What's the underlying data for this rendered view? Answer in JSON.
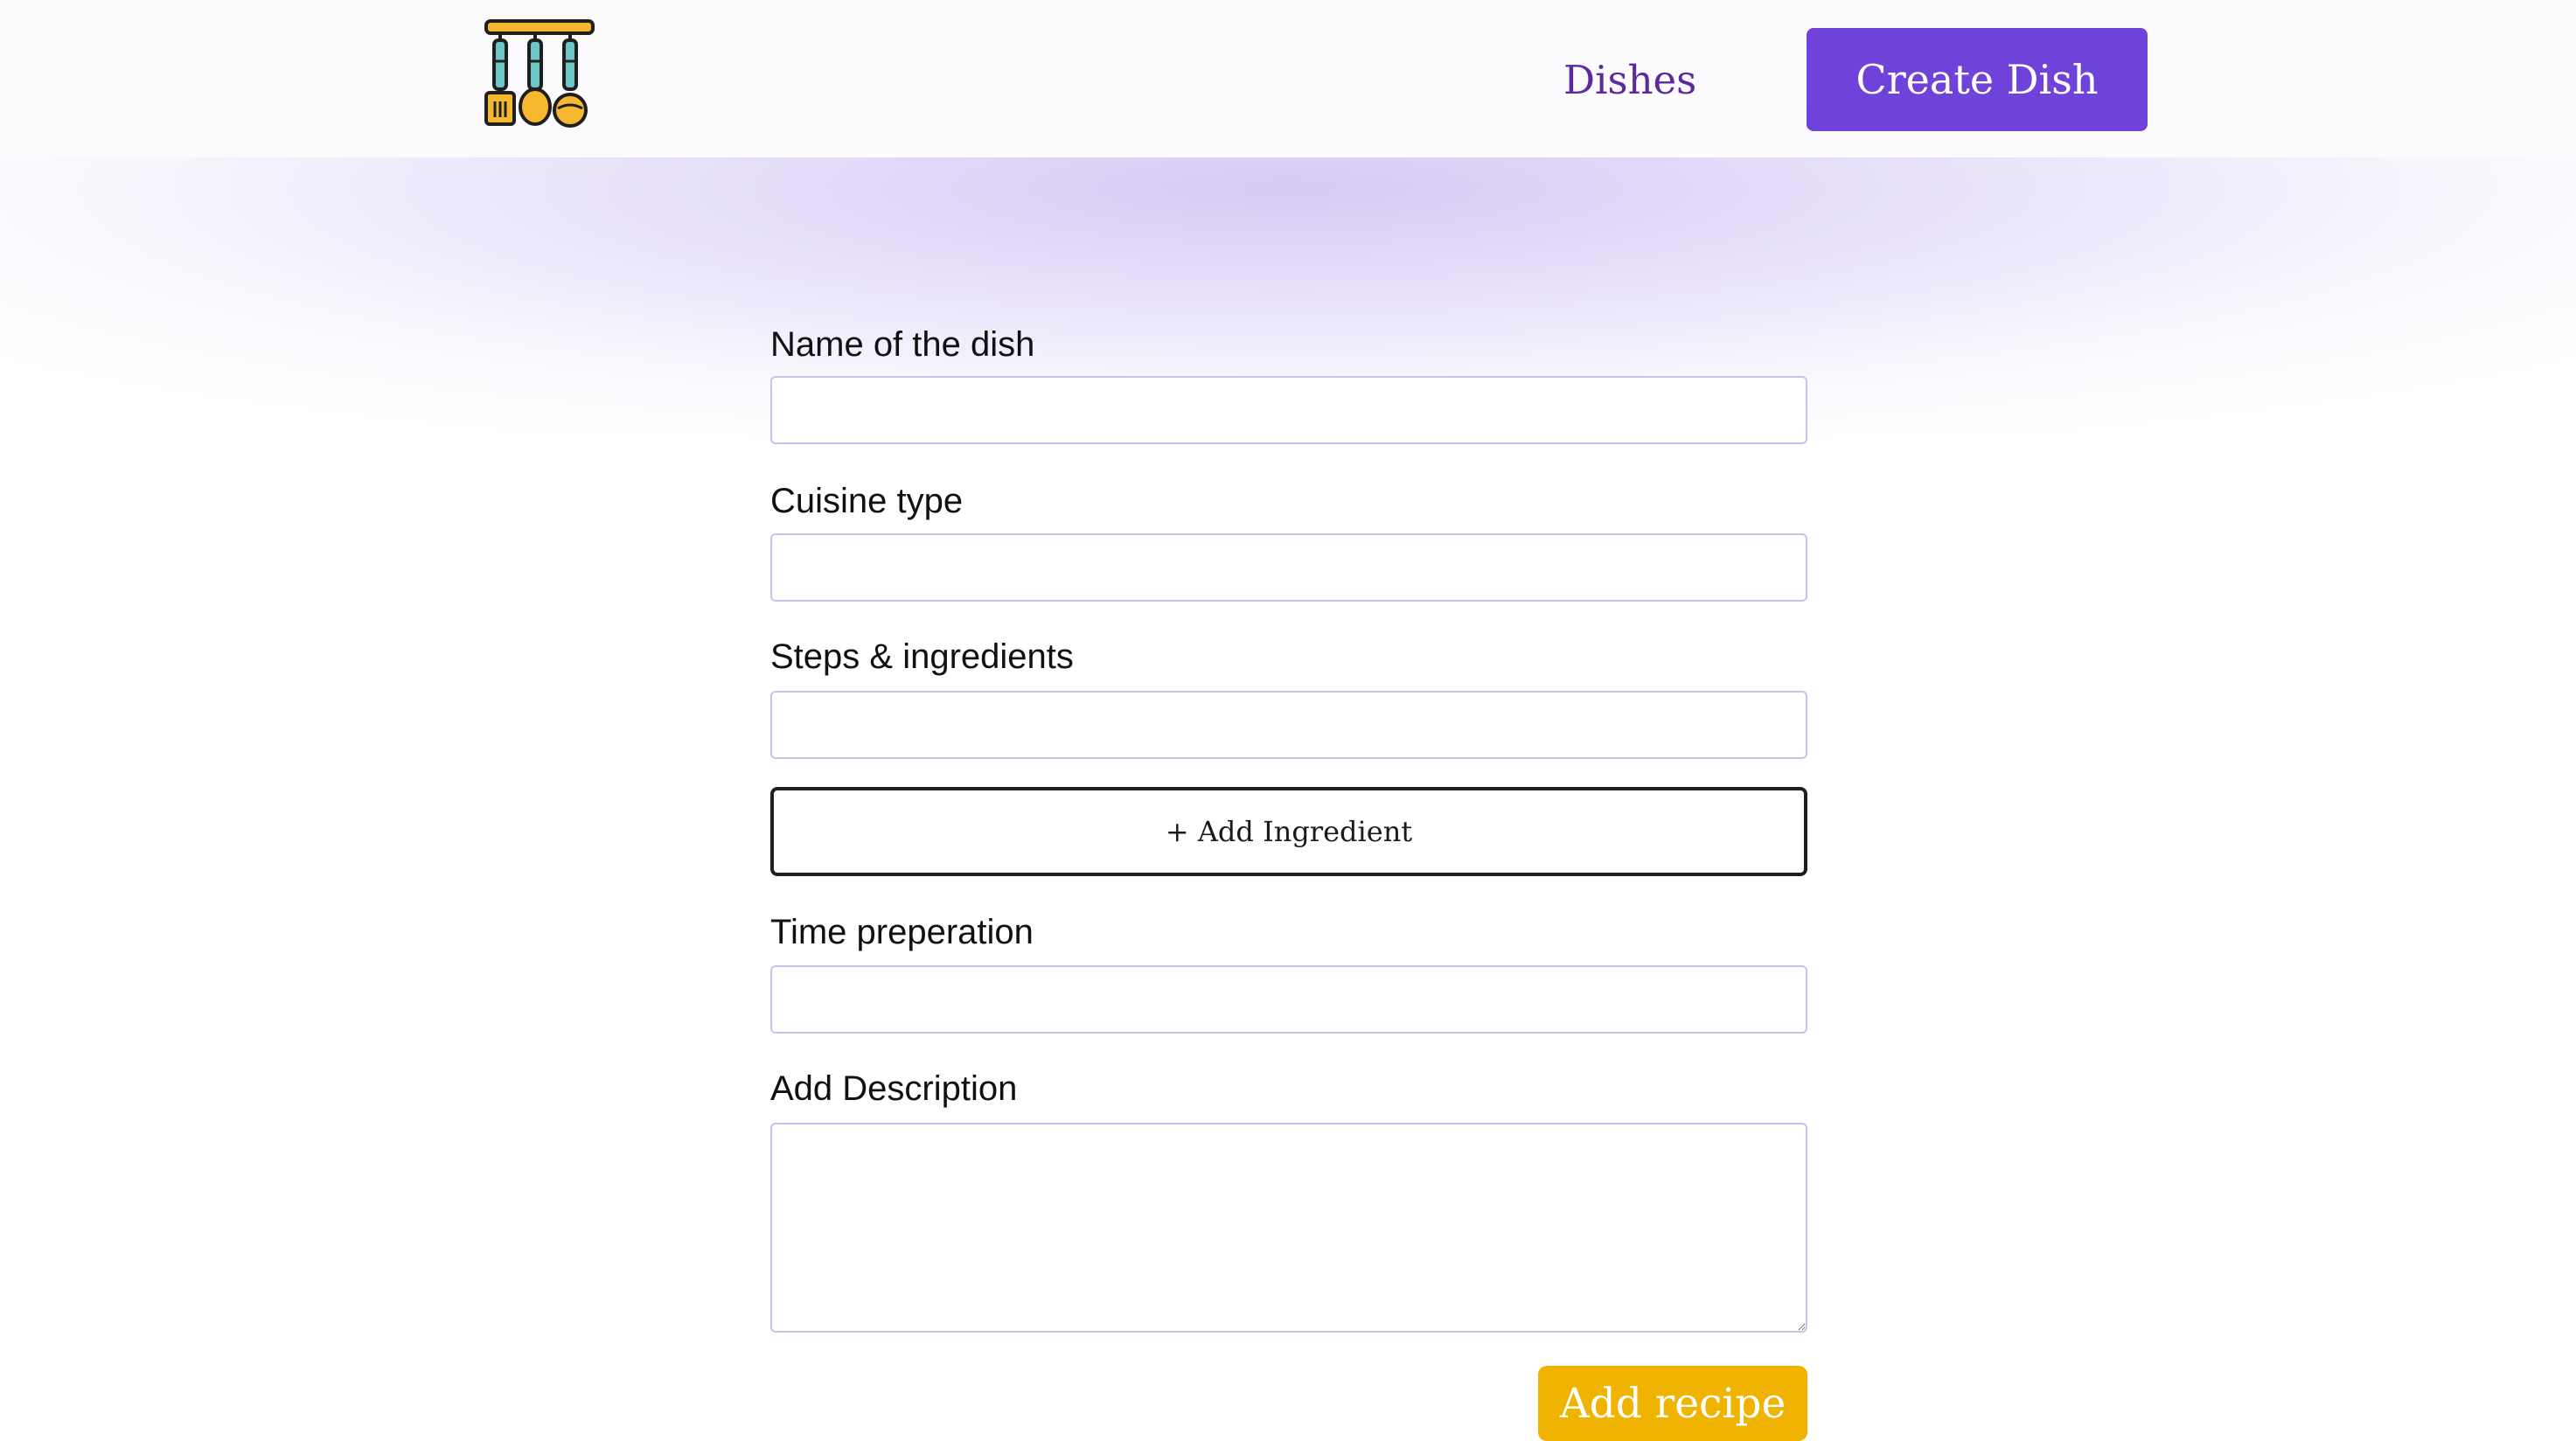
{
  "header": {
    "logo_icon": "kitchen-utensils-icon",
    "nav_dishes_label": "Dishes",
    "create_dish_label": "Create Dish"
  },
  "form": {
    "name_label": "Name of the dish",
    "name_value": "",
    "cuisine_label": "Cuisine type",
    "cuisine_value": "",
    "steps_label": "Steps & ingredients",
    "steps_value": "",
    "add_ingredient_label": "+ Add Ingredient",
    "time_label": "Time preperation",
    "time_value": "",
    "description_label": "Add Description",
    "description_value": "",
    "submit_label": "Add recipe"
  },
  "colors": {
    "brand_purple": "#6f42d9",
    "nav_link": "#5b2a9c",
    "submit_yellow": "#f0b400",
    "input_border": "#c9c2ec"
  }
}
